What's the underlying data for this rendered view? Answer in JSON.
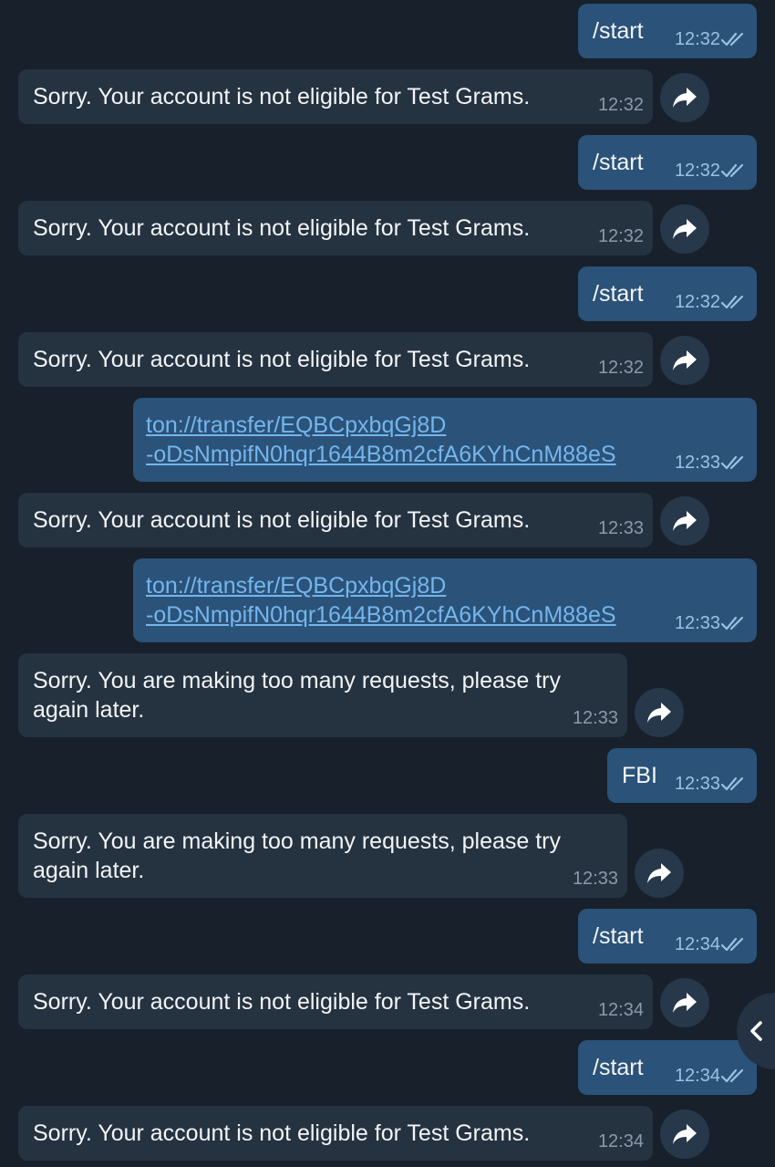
{
  "messages": [
    {
      "dir": "out",
      "text": "/start",
      "time": "12:32",
      "read": true
    },
    {
      "dir": "in",
      "text": "Sorry. Your account is not eligible for Test Grams.",
      "time": "12:32"
    },
    {
      "dir": "out",
      "text": "/start",
      "time": "12:32",
      "read": true
    },
    {
      "dir": "in",
      "text": "Sorry. Your account is not eligible for Test Grams.",
      "time": "12:32"
    },
    {
      "dir": "out",
      "text": "/start",
      "time": "12:32",
      "read": true
    },
    {
      "dir": "in",
      "text": "Sorry. Your account is not eligible for Test Grams.",
      "time": "12:32"
    },
    {
      "dir": "out",
      "text": "ton://transfer/EQBCpxbqGj8D\n-oDsNmpifN0hqr1644B8m2cfA6KYhCnM88eS",
      "time": "12:33",
      "read": true,
      "link": true
    },
    {
      "dir": "in",
      "text": "Sorry. Your account is not eligible for Test Grams.",
      "time": "12:33"
    },
    {
      "dir": "out",
      "text": "ton://transfer/EQBCpxbqGj8D\n-oDsNmpifN0hqr1644B8m2cfA6KYhCnM88eS",
      "time": "12:33",
      "read": true,
      "link": true
    },
    {
      "dir": "in",
      "text": "Sorry. You are making too many requests, please try\nagain later.",
      "time": "12:33"
    },
    {
      "dir": "out",
      "text": "FBI",
      "time": "12:33",
      "read": true
    },
    {
      "dir": "in",
      "text": "Sorry. You are making too many requests, please try\nagain later.",
      "time": "12:33"
    },
    {
      "dir": "out",
      "text": "/start",
      "time": "12:34",
      "read": true
    },
    {
      "dir": "in",
      "text": "Sorry. Your account is not eligible for Test Grams.",
      "time": "12:34"
    },
    {
      "dir": "out",
      "text": "/start",
      "time": "12:34",
      "read": true
    },
    {
      "dir": "in",
      "text": "Sorry. Your account is not eligible for Test Grams.",
      "time": "12:34"
    }
  ],
  "icons": {
    "forward": "forward-arrow-icon",
    "read_receipt": "double-check-icon",
    "side_button": "chevron-left-icon"
  },
  "colors": {
    "background": "#17202b",
    "incoming_bubble": "#253240",
    "outgoing_bubble": "#2b5278",
    "link": "#74b6ee",
    "forward_button": "#27384a"
  }
}
